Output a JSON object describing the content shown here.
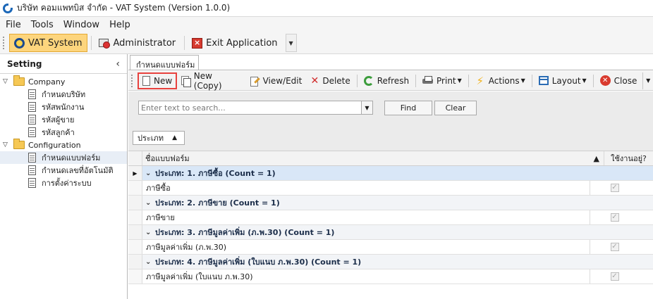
{
  "window": {
    "title": "บริษัท คอมแพทบิส จำกัด - VAT System (Version 1.0.0)"
  },
  "menu": {
    "items": [
      "File",
      "Tools",
      "Window",
      "Help"
    ]
  },
  "main_toolbar": {
    "vat_system": "VAT System",
    "administrator": "Administrator",
    "exit_application": "Exit Application"
  },
  "sidebar": {
    "title": "Setting",
    "tree": [
      {
        "label": "Company",
        "children": [
          "กำหนดบริษัท",
          "รหัสพนักงาน",
          "รหัสผู้ขาย",
          "รหัสลูกค้า"
        ]
      },
      {
        "label": "Configuration",
        "children": [
          "กำหนดแบบฟอร์ม",
          "กำหนดเลขที่อัตโนมัติ",
          "การตั้งค่าระบบ"
        ]
      }
    ],
    "selected": "กำหนดแบบฟอร์ม"
  },
  "tab": {
    "label": "กำหนดแบบฟอร์ม"
  },
  "toolbar": {
    "new": "New",
    "new_copy": "New (Copy)",
    "view_edit": "View/Edit",
    "delete": "Delete",
    "refresh": "Refresh",
    "print": "Print",
    "actions": "Actions",
    "layout": "Layout",
    "close": "Close"
  },
  "search": {
    "placeholder": "Enter text to search...",
    "find": "Find",
    "clear": "Clear"
  },
  "group_by": {
    "label": "ประเภท"
  },
  "grid": {
    "columns": {
      "name": "ชื่อแบบฟอร์ม",
      "active": "ใช้งานอยู่?"
    },
    "groups": [
      {
        "header": "ประเภท: 1. ภาษีซื้อ (Count = 1)",
        "rows": [
          {
            "name": "ภาษีซื้อ",
            "active": true
          }
        ]
      },
      {
        "header": "ประเภท: 2. ภาษีขาย (Count = 1)",
        "rows": [
          {
            "name": "ภาษีขาย",
            "active": true
          }
        ]
      },
      {
        "header": "ประเภท: 3. ภาษีมูลค่าเพิ่ม (ภ.พ.30) (Count = 1)",
        "rows": [
          {
            "name": "ภาษีมูลค่าเพิ่ม (ภ.พ.30)",
            "active": true
          }
        ]
      },
      {
        "header": "ประเภท: 4. ภาษีมูลค่าเพิ่ม (ใบแนบ ภ.พ.30) (Count = 1)",
        "rows": [
          {
            "name": "ภาษีมูลค่าเพิ่ม (ใบแนบ ภ.พ.30)",
            "active": true
          }
        ]
      }
    ]
  }
}
